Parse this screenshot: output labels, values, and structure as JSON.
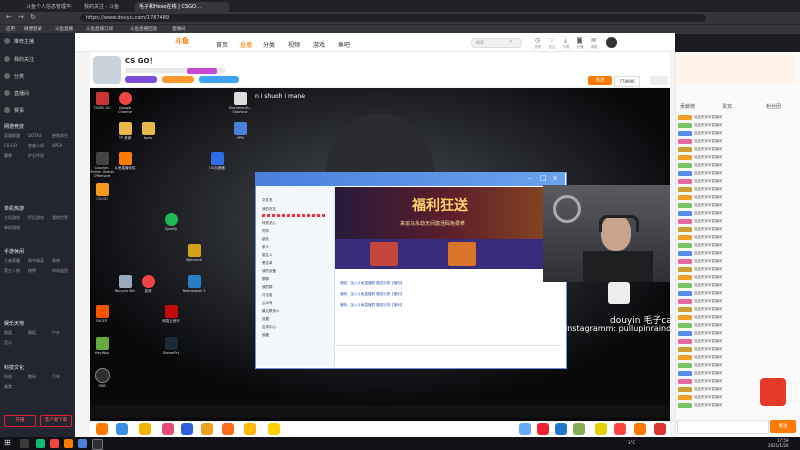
{
  "browser": {
    "tabs": [
      "斗鱼个人信息管理平台",
      "我的关注 - 斗鱼",
      "毛子和Hexo在线 | CSGO…"
    ],
    "url": "https://www.douyu.com/1787489",
    "bookmarks": [
      "应用",
      "微博登录",
      "斗鱼直播",
      "斗鱼直播订阅",
      "斗鱼直播回放",
      "直播间"
    ]
  },
  "sidebar": {
    "nav": [
      "推荐主播",
      "我的关注",
      "分类",
      "直播间",
      "赛事"
    ],
    "sections": [
      {
        "title": "网游竞技",
        "items": [
          "英雄联盟",
          "DOTA2",
          "绝地求生",
          "CS:GO",
          "穿越火线",
          "APEX",
          "魔兽",
          "炉石传说"
        ]
      },
      {
        "title": "单机热游",
        "items": [
          "主机游戏",
          "怀旧游戏",
          "我的世界",
          "单机游戏"
        ]
      },
      {
        "title": "手游休闲",
        "items": [
          "王者荣耀",
          "和平精英",
          "原神",
          "第五人格",
          "棋牌",
          "休闲益智"
        ]
      },
      {
        "title": "娱乐天地",
        "items": [
          "颜值",
          "舞蹈",
          "户外",
          "音乐"
        ]
      },
      {
        "title": "科技文化",
        "items": [
          "科技",
          "数码",
          "汽车",
          "美食"
        ]
      }
    ],
    "buttons": [
      "开播",
      "客户端下载"
    ]
  },
  "site": {
    "logo": "斗鱼",
    "nav": [
      "首页",
      "直播",
      "分类",
      "视频",
      "游戏",
      "鱼吧"
    ],
    "search_placeholder": "搜索",
    "header_icons": [
      "历史",
      "关注",
      "下载",
      "开播",
      "消息"
    ],
    "room_title": "CS GO！",
    "follow_label": "关注",
    "follow_count": "778996"
  },
  "video": {
    "overlay_text": "n i shuoh i mane",
    "watermark_line1": "douyin 毛子cago",
    "watermark_line2": "instagramm: pullupinraindrop",
    "desktop_icons": [
      "TAISEI AC",
      "Google Chrome",
      "TP 资源",
      "tools",
      "Documents - Shortcut",
      "VPN",
      "Counter-Strike: Global Offensive",
      "斗鱼直播伴侣",
      "UU加速器",
      "Spotify",
      "CS:GO",
      "Recycle Bin",
      "游戏",
      "Welcome",
      "FACEIT",
      "Teamspeak 3",
      "网易云音乐",
      "HeyWay",
      "SteamPrt",
      "OBS"
    ],
    "qq": {
      "banner_title": "福利狂送",
      "banner_sub": "来追马永劫无间激活码免费拿",
      "group_items": [
        "文件夹",
        "我的好友",
        "特别关心",
        "同学",
        "朋友",
        "家人",
        "陌生人",
        "黑名单",
        "我的设备",
        "群聊",
        "我的群",
        "讨论组",
        "公众号",
        "最近联系人",
        "设置",
        "应用中心",
        "收藏"
      ],
      "messages": [
        "通知：加入斗鱼直播群 赠送礼物【福利】",
        "通知：加入斗鱼直播群 赠送礼物【福利】",
        "通知：加入斗鱼直播群 赠送礼物【福利】"
      ]
    }
  },
  "chat": {
    "header": [
      "贡献榜",
      "贵宾",
      "粉丝团"
    ],
    "messages": [
      "欢迎来到本直播间",
      "欢迎来到本直播间",
      "欢迎来到本直播间",
      "欢迎来到本直播间",
      "欢迎来到本直播间",
      "欢迎来到本直播间",
      "欢迎来到本直播间",
      "欢迎来到本直播间",
      "欢迎来到本直播间",
      "欢迎来到本直播间",
      "欢迎来到本直播间",
      "欢迎来到本直播间",
      "欢迎来到本直播间",
      "欢迎来到本直播间",
      "欢迎来到本直播间",
      "欢迎来到本直播间",
      "欢迎来到本直播间",
      "欢迎来到本直播间",
      "欢迎来到本直播间",
      "欢迎来到本直播间",
      "欢迎来到本直播间",
      "欢迎来到本直播间",
      "欢迎来到本直播间",
      "欢迎来到本直播间",
      "欢迎来到本直播间",
      "欢迎来到本直播间",
      "欢迎来到本直播间",
      "欢迎来到本直播间",
      "欢迎来到本直播间",
      "欢迎来到本直播间",
      "欢迎来到本直播间",
      "欢迎来到本直播间",
      "欢迎来到本直播间",
      "欢迎来到本直播间",
      "欢迎来到本直播间",
      "欢迎来到本直播间",
      "欢迎来到本直播间"
    ],
    "send_label": "发送"
  },
  "os": {
    "time": "17:59",
    "date": "2021/1/26",
    "temp": "3°C"
  },
  "colors": {
    "douyu_orange": "#ff7a00",
    "sidebar_bg": "#23262e",
    "qq_blue": "#4a7fdc"
  }
}
